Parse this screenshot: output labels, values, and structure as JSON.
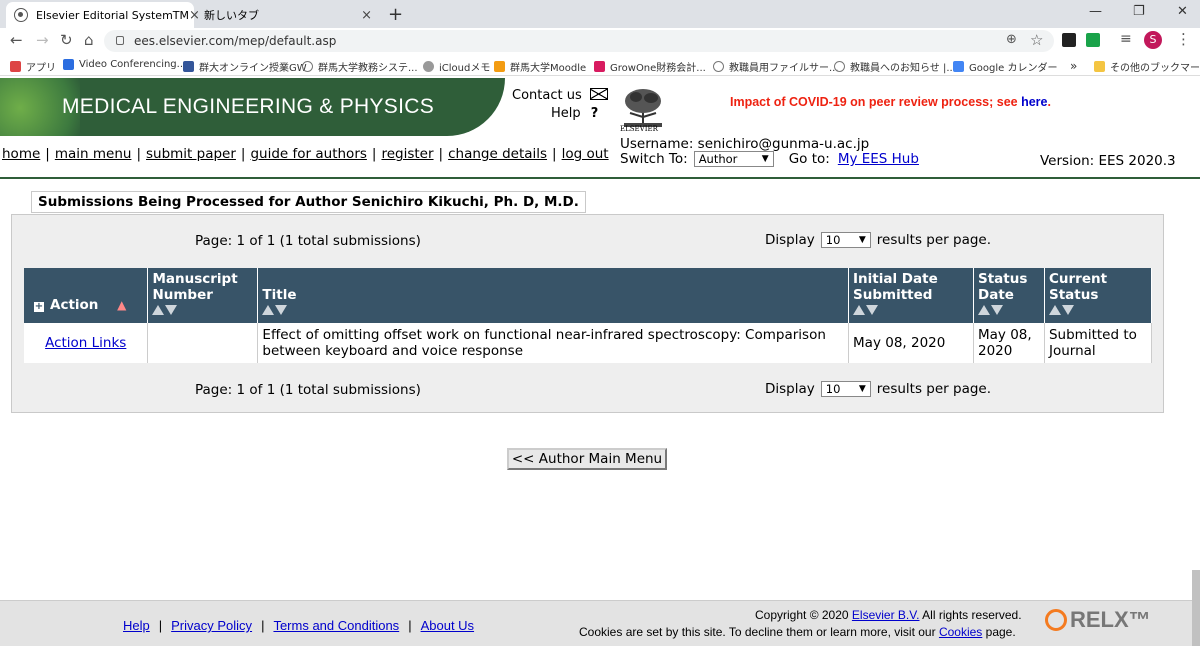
{
  "browser": {
    "tabs": [
      {
        "title": "Elsevier Editorial SystemTM",
        "close": "×"
      },
      {
        "title": "新しいタブ",
        "close": "×"
      }
    ],
    "new_tab": "+",
    "window_controls": {
      "minimize": "—",
      "maximize": "❐",
      "close": "✕"
    },
    "address": "ees.elsevier.com/mep/default.asp",
    "profile_initial": "S",
    "bookmarks": [
      "アプリ",
      "Video Conferencing...",
      "群大オンライン授業GW",
      "群馬大学教務システ...",
      "iCloudメモ",
      "群馬大学Moodle",
      "GrowOne財務会計...",
      "教職員用ファイルサー...",
      "教職員へのお知らせ |...",
      "Google カレンダー",
      "»",
      "その他のブックマーク"
    ]
  },
  "header": {
    "journal_title": "MEDICAL ENGINEERING & PHYSICS",
    "contact": "Contact us",
    "help": "Help",
    "publisher_logo_text": "ELSEVIER",
    "covid_notice": "Impact of COVID-19 on peer review process; see",
    "covid_link": "here",
    "covid_suffix": ".",
    "menu": [
      "home",
      "main menu",
      "submit paper",
      "guide for authors",
      "register",
      "change details",
      "log out"
    ],
    "menu_sep": "|",
    "username": "Username: senichiro@gunma-u.ac.jp",
    "switch_to_label": "Switch To:",
    "role": "Author",
    "goto_label": "Go to:",
    "goto_link": "My EES Hub",
    "version": "Version: EES 2020.3"
  },
  "content": {
    "panel_title": "Submissions Being Processed for Author Senichiro Kikuchi, Ph. D, M.D.",
    "page_info": "Page: 1 of 1 (1 total submissions)",
    "display_label": "Display",
    "per_page": "10",
    "results_label": "results per page.",
    "columns": [
      "Action",
      "Manuscript Number",
      "Title",
      "Initial Date Submitted",
      "Status Date",
      "Current Status"
    ],
    "rows": [
      {
        "action": "Action Links",
        "manuscript_number": "",
        "title": "Effect of omitting offset work on functional near-infrared spectroscopy: Comparison between keyboard and voice response",
        "initial_date": "May 08, 2020",
        "status_date": "May 08, 2020",
        "current_status": "Submitted to Journal"
      }
    ],
    "main_menu_button": "<< Author Main Menu"
  },
  "footer": {
    "links": [
      "Help",
      "Privacy Policy",
      "Terms and Conditions",
      "About Us"
    ],
    "copyright_prefix": "Copyright © 2020",
    "copyright_link": "Elsevier B.V.",
    "copyright_suffix": "All rights reserved.",
    "cookies_prefix": "Cookies are set by this site. To decline them or learn more, visit our",
    "cookies_link": "Cookies",
    "cookies_suffix": "page.",
    "relx_logo": "RELX™"
  }
}
